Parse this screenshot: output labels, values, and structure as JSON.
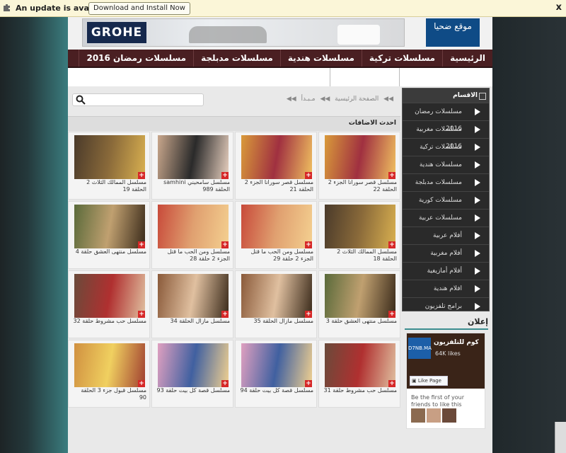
{
  "update_bar": {
    "message": "An update is available",
    "button_label": "Download and Install Now",
    "close_label": "x"
  },
  "ads": {
    "banner_brand": "GROHE",
    "site_logo_text": "موقع ضحيا",
    "section_title": "إعلان"
  },
  "nav": {
    "items": [
      "الرئيسية",
      "مسلسلات تركية",
      "مسلسلات هندية",
      "مسلسلات مدبلجة",
      "مسلسلات رمضان 2016"
    ]
  },
  "search": {
    "placeholder": ""
  },
  "breadcrumb": {
    "home": "الصفحة الرئيسية",
    "current": "مـبـدأ"
  },
  "latest": {
    "title": "احدث الاضافات"
  },
  "cards": [
    {
      "caption": "مسلسل قصر سورانا الجزء 2 الحلقة 22"
    },
    {
      "caption": "مسلسل قصر سورانا الجزء 2 الحلقة 21"
    },
    {
      "caption": "مسلسل سامحيني samhini الحلقة 989"
    },
    {
      "caption": "مسلسل الممالك الثلاث 2 الحلقة 19"
    },
    {
      "caption": "مسلسل الممالك الثلاث 2 الحلقة 18"
    },
    {
      "caption": "مسلسل ومن الحب ما قتل الجزء 2 حلقة 29"
    },
    {
      "caption": "مسلسل ومن الحب ما قتل الجزء 2 حلقة 28"
    },
    {
      "caption": "مسلسل منتهى العشق حلقة 4"
    },
    {
      "caption": "مسلسل منتهى العشق حلقة 3"
    },
    {
      "caption": "مسلسل مازال الحلقة 35"
    },
    {
      "caption": "مسلسل مازال الحلقة 34"
    },
    {
      "caption": "مسلسل حب مشروط حلقة 32"
    },
    {
      "caption": "مسلسل حب مشروط حلقة 31"
    },
    {
      "caption": "مسلسل قصة كل بيت حلقة 94"
    },
    {
      "caption": "مسلسل قصة كل بيت حلقة 93"
    },
    {
      "caption": "مسلسل قبول جزء 3 الحلقة 90"
    }
  ],
  "sidebar": {
    "title": "الاقسام",
    "items": [
      "مسلسلات رمضان 2016",
      "مسلسلات مغربية 2016",
      "مسلسلات تركية",
      "مسلسلات هندية",
      "مسلسلات مدبلجة",
      "مسلسلات كورية",
      "مسلسلات عربية",
      "أفلام عربية",
      "أفلام مغربية",
      "أفلام أمازيغية",
      "افلام هندية",
      "برامج تلفزيون"
    ]
  },
  "facebook": {
    "page_name": "كوم للتلفزيون",
    "logo_text": "D7NB.MA",
    "likes": "64K likes",
    "like_button": "Like Page",
    "first_text": "Be the first of your friends to like this"
  },
  "colors": {
    "nav_bg": "#4a1f22",
    "sidebar_bg": "#2a2a2a",
    "accent_plus": "#d62828",
    "update_bar_bg": "#fbf6d8"
  }
}
